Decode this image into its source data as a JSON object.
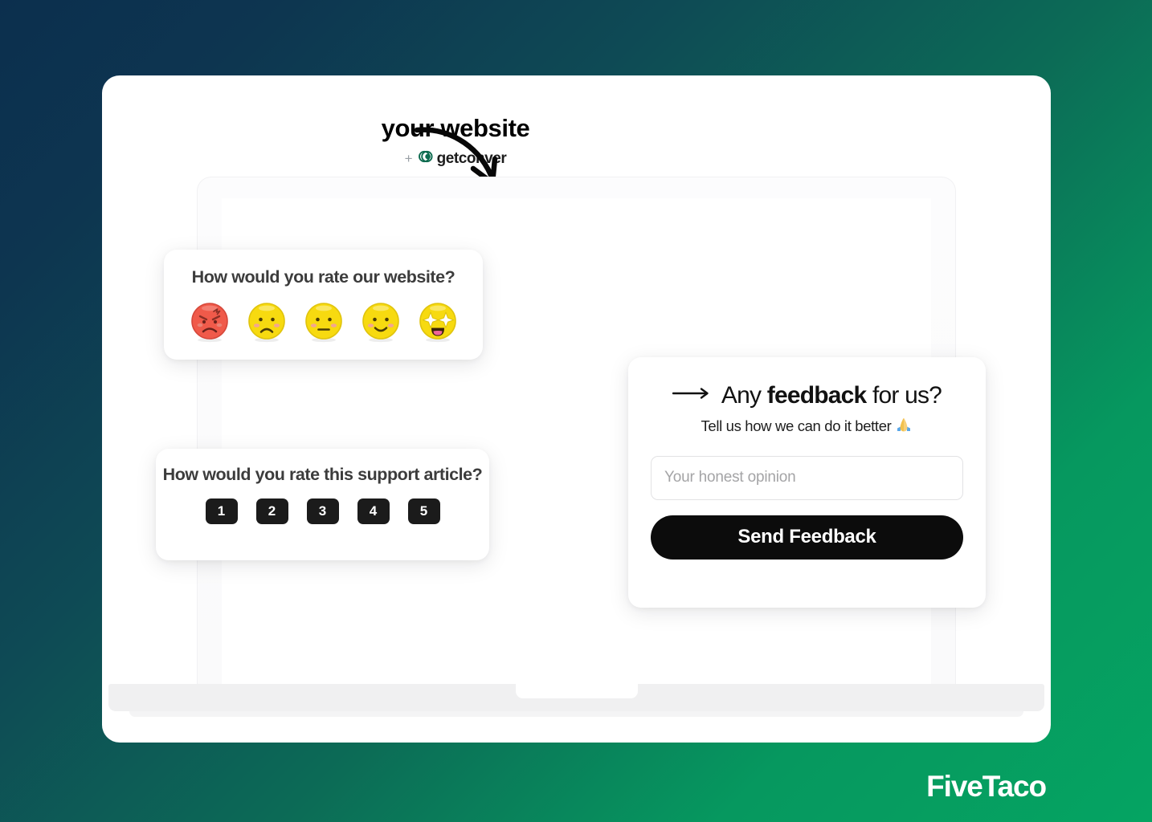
{
  "background": {
    "gradient_from": "#0c2f4e",
    "gradient_mid": "#0e4a55",
    "gradient_to": "#05a462"
  },
  "annotation": {
    "title": "your website",
    "plus": "+",
    "brand_name": "getconver",
    "brand_icon": "getconver-swirl-icon",
    "brand_color": "#0d6b4f",
    "arrow_icon": "curved-down-arrow-icon"
  },
  "emoji_rating_card": {
    "title": "How would you rate our website?",
    "options": [
      {
        "name": "angry",
        "icon": "angry-face-emoji",
        "value": "1",
        "color": "#f05a4a"
      },
      {
        "name": "frowning",
        "icon": "frowning-face-emoji",
        "value": "2",
        "color": "#f7da10"
      },
      {
        "name": "neutral",
        "icon": "neutral-face-emoji",
        "value": "3",
        "color": "#f7da10"
      },
      {
        "name": "slightly-smiling",
        "icon": "slightly-smiling-face-emoji",
        "value": "4",
        "color": "#f7da10"
      },
      {
        "name": "star-struck",
        "icon": "star-struck-face-emoji",
        "value": "5",
        "color": "#f7da10"
      }
    ]
  },
  "numeric_rating_card": {
    "title": "How would you rate this support article?",
    "options": [
      "1",
      "2",
      "3",
      "4",
      "5"
    ],
    "button_color": "#1b1b1b"
  },
  "feedback_card": {
    "arrow_icon": "right-arrow-icon",
    "title_lead": "Any ",
    "title_bold": "feedback",
    "title_tail": " for us?",
    "subtitle": "Tell us how we can do it better",
    "subtitle_emoji": "🙏",
    "input_placeholder": "Your honest opinion",
    "input_value": "",
    "submit_label": "Send Feedback",
    "submit_color": "#0c0c0c"
  },
  "watermark": {
    "text": "FiveTaco"
  }
}
